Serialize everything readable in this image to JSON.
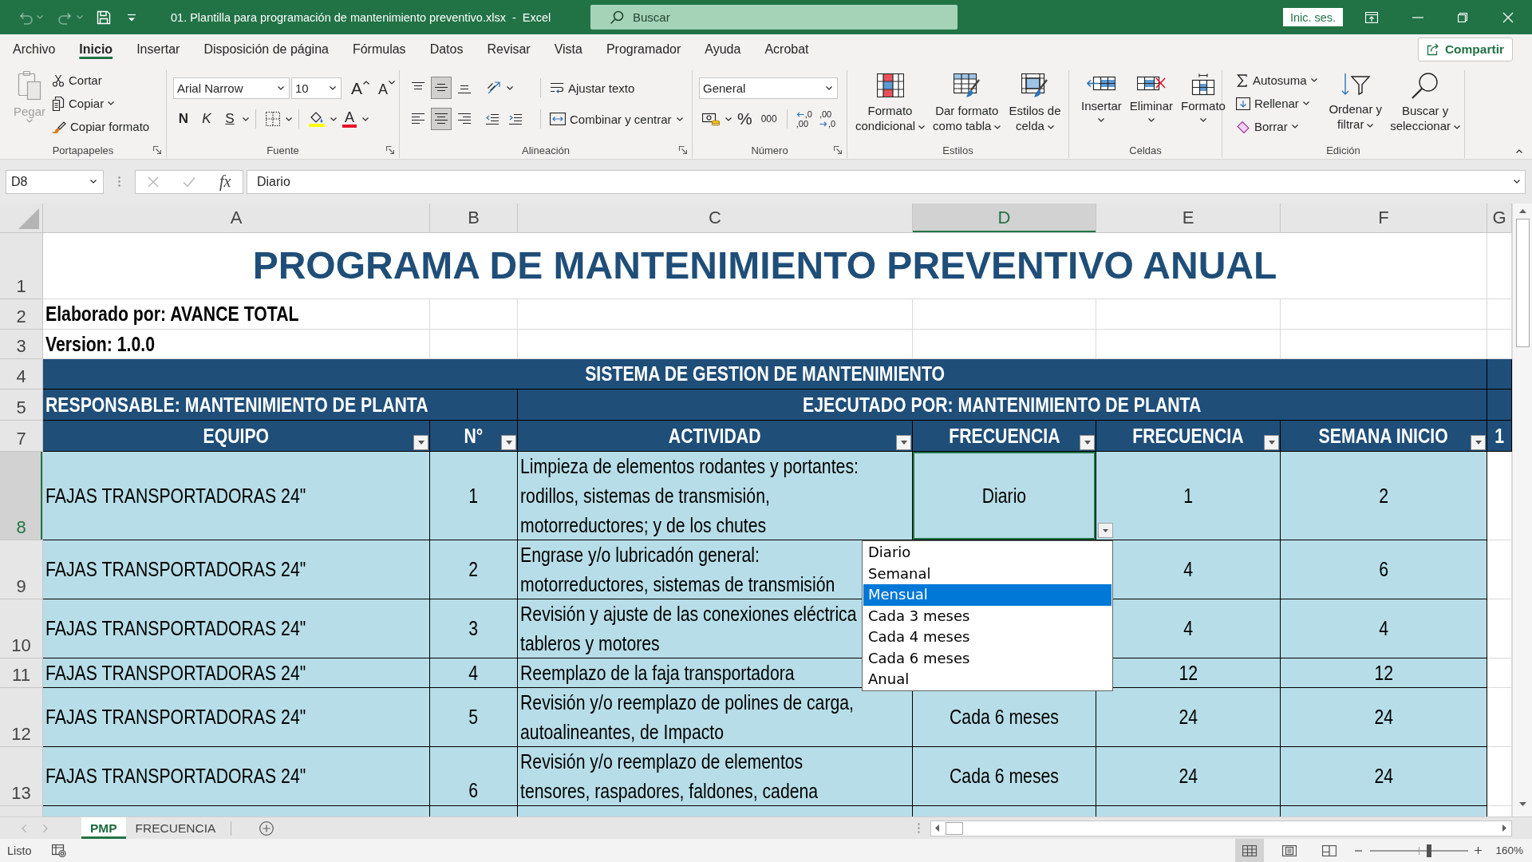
{
  "title_bar": {
    "undo": {
      "disabled": true
    },
    "redo": {
      "disabled": true
    },
    "title": "01. Plantilla para programación de mantenimiento preventivo.xlsx  -  Excel",
    "search": {
      "placeholder": "Buscar"
    },
    "sign_in_button": "Inic. ses."
  },
  "ribbon": {
    "tabs": [
      {
        "label": "Archivo",
        "selected": false
      },
      {
        "label": "Inicio",
        "selected": true
      },
      {
        "label": "Insertar",
        "selected": false
      },
      {
        "label": "Disposición de página",
        "selected": false
      },
      {
        "label": "Fórmulas",
        "selected": false
      },
      {
        "label": "Datos",
        "selected": false
      },
      {
        "label": "Revisar",
        "selected": false
      },
      {
        "label": "Vista",
        "selected": false
      },
      {
        "label": "Programador",
        "selected": false
      },
      {
        "label": "Ayuda",
        "selected": false
      },
      {
        "label": "Acrobat",
        "selected": false
      }
    ],
    "share_button": "Compartir",
    "clipboard": {
      "label": "Portapapeles",
      "paste": {
        "label": "Pegar",
        "disabled": true
      },
      "commands": [
        "Cortar",
        "Copiar",
        "Copiar formato"
      ]
    },
    "font": {
      "label": "Fuente",
      "font_name": "Arial Narrow",
      "font_size": "10",
      "size_buttons": [
        "A",
        "A"
      ],
      "style_buttons": [
        "N",
        "K",
        "S"
      ],
      "font_color_button": "A"
    },
    "alignment": {
      "label": "Alineación",
      "vertical_align": [
        {
          "selected": false
        },
        {
          "selected": true
        },
        {
          "selected": false
        }
      ],
      "horizontal_align": [
        {
          "selected": false
        },
        {
          "selected": true
        },
        {
          "selected": false
        }
      ],
      "wrap_text": "Ajustar texto",
      "merge_center": "Combinar y centrar"
    },
    "number": {
      "label": "Número",
      "format": "General",
      "percent_button": "%",
      "thousands_button": "000",
      "decimal_buttons": [
        [
          ",0",
          ",00"
        ],
        [
          ",00",
          ",0"
        ]
      ]
    },
    "styles": {
      "label": "Estilos",
      "buttons": [
        [
          "Formato",
          "condicional"
        ],
        [
          "Dar formato",
          "como tabla"
        ],
        [
          "Estilos de",
          "celda"
        ]
      ]
    },
    "cells": {
      "label": "Celdas",
      "buttons": [
        "Insertar",
        "Eliminar",
        "Formato"
      ]
    },
    "editing": {
      "label": "Edición",
      "commands": [
        "Autosuma",
        "Rellenar",
        "Borrar"
      ],
      "buttons": [
        [
          "Ordenar y",
          "filtrar"
        ],
        [
          "Buscar y",
          "seleccionar"
        ]
      ]
    }
  },
  "formula_bar": {
    "name_box": "D8",
    "function_button": "fx",
    "formula": "Diario"
  },
  "sheet": {
    "columns": [
      {
        "label": "A",
        "selected": false
      },
      {
        "label": "B",
        "selected": false
      },
      {
        "label": "C",
        "selected": false
      },
      {
        "label": "D",
        "selected": true
      },
      {
        "label": "E",
        "selected": false
      },
      {
        "label": "F",
        "selected": false
      },
      {
        "label": "G",
        "selected": false
      }
    ],
    "title_row": {
      "row_label": "1",
      "selected": false,
      "title": "PROGRAMA DE MANTENIMIENTO PREVENTIVO ANUAL"
    },
    "info_rows": [
      {
        "row_label": "2",
        "selected": false,
        "text": "Elaborado por: AVANCE TOTAL"
      },
      {
        "row_label": "3",
        "selected": false,
        "text": "Version: 1.0.0"
      }
    ],
    "section_row": {
      "row_label": "4",
      "selected": false,
      "text": "SISTEMA DE GESTION DE MANTENIMIENTO"
    },
    "owner_row": {
      "row_label": "5",
      "selected": false,
      "responsible": "RESPONSABLE: MANTENIMIENTO DE PLANTA",
      "executed_by": "EJECUTADO POR: MANTENIMIENTO DE PLANTA"
    },
    "header_row": {
      "row_label": "7",
      "selected": false,
      "headers": [
        {
          "label": "EQUIPO",
          "filter": true
        },
        {
          "label": "N°",
          "filter": true
        },
        {
          "label": "ACTIVIDAD",
          "filter": true
        },
        {
          "label": "FRECUENCIA",
          "filter": true
        },
        {
          "label": "FRECUENCIA",
          "filter": true
        },
        {
          "label": "SEMANA INICIO",
          "filter": true
        },
        {
          "label": "1",
          "filter": false
        }
      ]
    },
    "data_rows": [
      {
        "row_label": "8",
        "selected": true,
        "equipment": "FAJAS TRANSPORTADORAS 24\"",
        "number": "1",
        "number_at_bottom": false,
        "activity": [
          "Limpieza de elementos rodantes y portantes:",
          "rodillos, sistemas de transmisión,",
          "motorreductores; y de los chutes"
        ],
        "frequency": "Diario",
        "frequency_2": "1",
        "start_week": "2"
      },
      {
        "row_label": "9",
        "selected": false,
        "equipment": "FAJAS TRANSPORTADORAS 24\"",
        "number": "2",
        "number_at_bottom": false,
        "activity": [
          "Engrase y/o lubricadón general:",
          "motorreductores, sistemas de transmisión"
        ],
        "frequency_2": "4",
        "start_week": "6"
      },
      {
        "row_label": "10",
        "selected": false,
        "equipment": "FAJAS TRANSPORTADORAS 24\"",
        "number": "3",
        "number_at_bottom": false,
        "activity": [
          "Revisión y ajuste de las conexiones eléctrica",
          "tableros y motores"
        ],
        "frequency_2": "4",
        "start_week": "4"
      },
      {
        "row_label": "11",
        "selected": false,
        "equipment": "FAJAS TRANSPORTADORAS 24\"",
        "number": "4",
        "number_at_bottom": false,
        "activity": [
          "Reemplazo de la faja transportadora"
        ],
        "frequency_2": "12",
        "start_week": "12"
      },
      {
        "row_label": "12",
        "selected": false,
        "equipment": "FAJAS TRANSPORTADORAS 24\"",
        "number": "5",
        "number_at_bottom": false,
        "activity": [
          "Revisión y/o reemplazo de polines de carga,",
          "autoalineantes, de Impacto"
        ],
        "frequency": "Cada 6 meses",
        "frequency_2": "24",
        "start_week": "24"
      },
      {
        "row_label": "13",
        "selected": false,
        "equipment": "FAJAS TRANSPORTADORAS 24\"",
        "number": "6",
        "number_at_bottom": true,
        "activity": [
          "Revisión y/o reemplazo de elementos",
          "tensores, raspadores, faldones, cadena"
        ],
        "frequency": "Cada 6 meses",
        "frequency_2": "24",
        "start_week": "24"
      }
    ]
  },
  "validation_list": {
    "items": [
      {
        "label": "Diario",
        "selected": false
      },
      {
        "label": "Semanal",
        "selected": false
      },
      {
        "label": "Mensual",
        "selected": true
      },
      {
        "label": "Cada 3 meses",
        "selected": false
      },
      {
        "label": "Cada 4 meses",
        "selected": false
      },
      {
        "label": "Cada 6 meses",
        "selected": false
      },
      {
        "label": "Anual",
        "selected": false
      }
    ]
  },
  "sheet_tabs": [
    {
      "label": "PMP",
      "selected": true
    },
    {
      "label": "FRECUENCIA",
      "selected": false
    }
  ],
  "status_bar": {
    "status": "Listo",
    "views": [
      {
        "selected": true
      },
      {
        "selected": false
      },
      {
        "selected": false
      }
    ],
    "zoom": {
      "level": 0.6,
      "label": "160%"
    }
  }
}
